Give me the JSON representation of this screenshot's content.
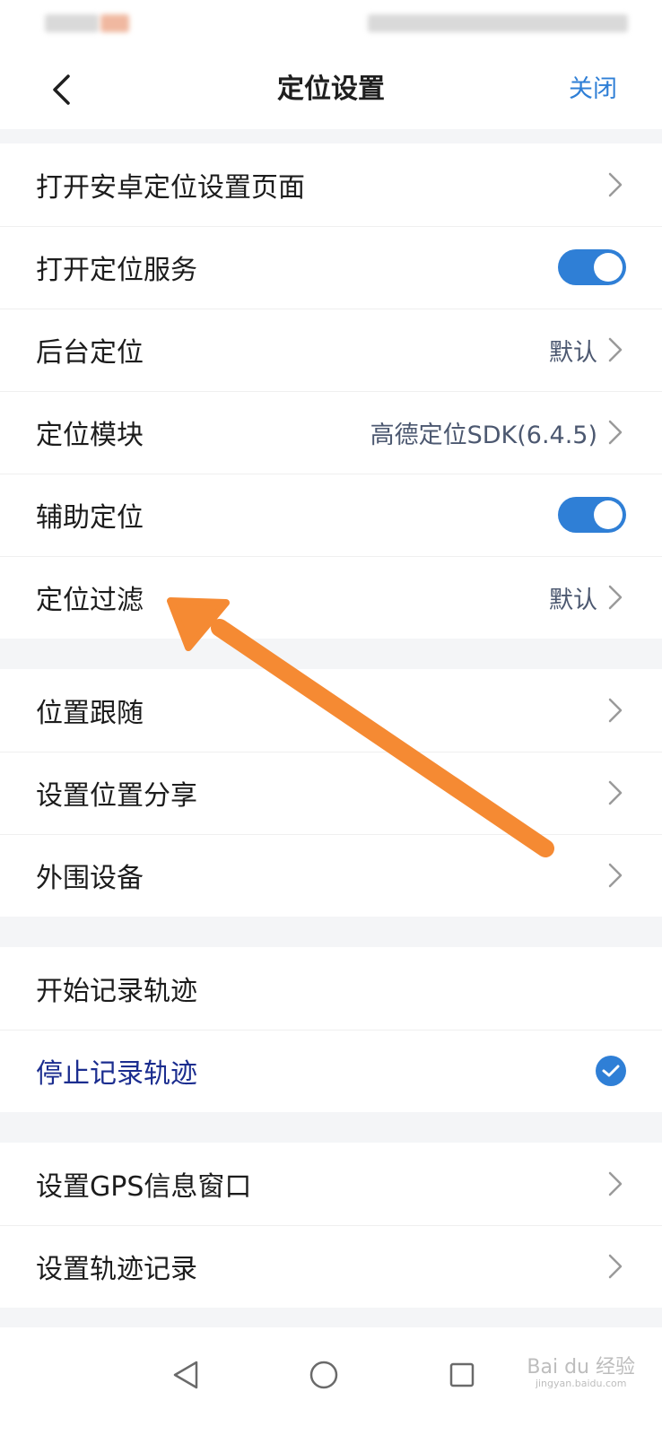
{
  "nav": {
    "title": "定位设置",
    "close_label": "关闭"
  },
  "groups": [
    [
      {
        "label": "打开安卓定位设置页面",
        "type": "chevron"
      },
      {
        "label": "打开定位服务",
        "type": "toggle",
        "on": true
      },
      {
        "label": "后台定位",
        "type": "chevron",
        "value": "默认"
      },
      {
        "label": "定位模块",
        "type": "chevron",
        "value": "高德定位SDK(6.4.5)"
      },
      {
        "label": "辅助定位",
        "type": "toggle",
        "on": true
      },
      {
        "label": "定位过滤",
        "type": "chevron",
        "value": "默认"
      }
    ],
    [
      {
        "label": "位置跟随",
        "type": "chevron"
      },
      {
        "label": "设置位置分享",
        "type": "chevron"
      },
      {
        "label": "外围设备",
        "type": "chevron"
      }
    ],
    [
      {
        "label": "开始记录轨迹",
        "type": "none"
      },
      {
        "label": "停止记录轨迹",
        "type": "check",
        "selected": true
      }
    ],
    [
      {
        "label": "设置GPS信息窗口",
        "type": "chevron"
      },
      {
        "label": "设置轨迹记录",
        "type": "chevron"
      }
    ]
  ],
  "watermark": {
    "brand": "Bai du 经验",
    "url": "jingyan.baidu.com"
  },
  "colors": {
    "accent": "#2f7fd6",
    "annotation_arrow": "#f58a33",
    "active_text": "#1b2d8f"
  },
  "icons": {
    "back": "chevron-left-icon",
    "row": "chevron-right-icon",
    "check": "checkmark-icon",
    "system": [
      "back-triangle-icon",
      "home-circle-icon",
      "recents-square-icon"
    ]
  }
}
